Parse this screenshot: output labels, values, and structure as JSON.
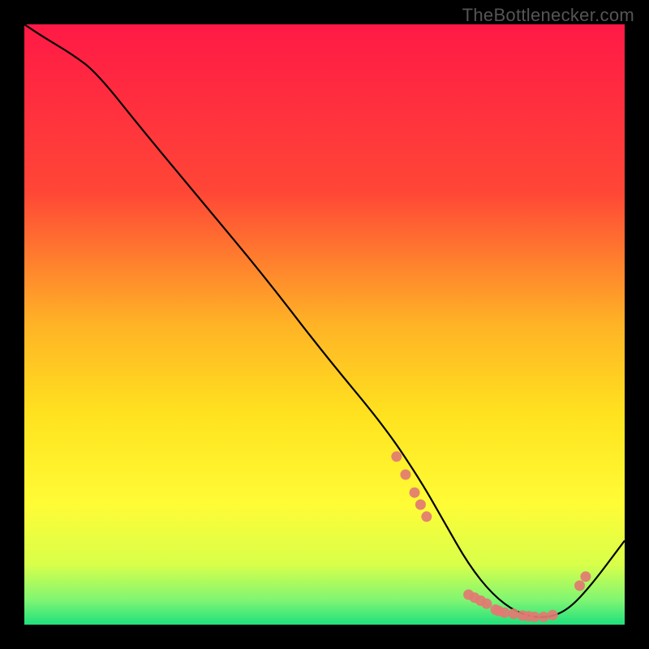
{
  "watermark": "TheBottlenecker.com",
  "chart_data": {
    "type": "line",
    "title": "",
    "xlabel": "",
    "ylabel": "",
    "xlim": [
      0,
      100
    ],
    "ylim": [
      0,
      100
    ],
    "series": [
      {
        "name": "curve",
        "x": [
          0,
          3,
          8,
          12,
          20,
          30,
          40,
          50,
          60,
          66,
          70,
          74,
          78,
          82,
          86,
          90,
          94,
          100
        ],
        "y": [
          100,
          98,
          95,
          92,
          82,
          70,
          58,
          45,
          33,
          24,
          17,
          10,
          5,
          2,
          1,
          2,
          6,
          14
        ]
      }
    ],
    "highlight_points": {
      "x": [
        62,
        63.5,
        65,
        66,
        67,
        74,
        75,
        76,
        77,
        78.5,
        79,
        80,
        81.5,
        83,
        84,
        85,
        86.5,
        88,
        92.5,
        93.5
      ],
      "y": [
        28,
        25,
        22,
        20,
        18,
        5,
        4.5,
        4,
        3.5,
        2.5,
        2.3,
        2,
        1.8,
        1.5,
        1.4,
        1.3,
        1.3,
        1.6,
        6.5,
        8
      ]
    },
    "gradient_stops": [
      {
        "offset": 0.0,
        "color": "#ff1946"
      },
      {
        "offset": 0.28,
        "color": "#ff4736"
      },
      {
        "offset": 0.5,
        "color": "#ffb326"
      },
      {
        "offset": 0.65,
        "color": "#ffe21f"
      },
      {
        "offset": 0.8,
        "color": "#fffc36"
      },
      {
        "offset": 0.9,
        "color": "#d8ff4a"
      },
      {
        "offset": 0.96,
        "color": "#7ef573"
      },
      {
        "offset": 1.0,
        "color": "#1fe07c"
      }
    ]
  }
}
